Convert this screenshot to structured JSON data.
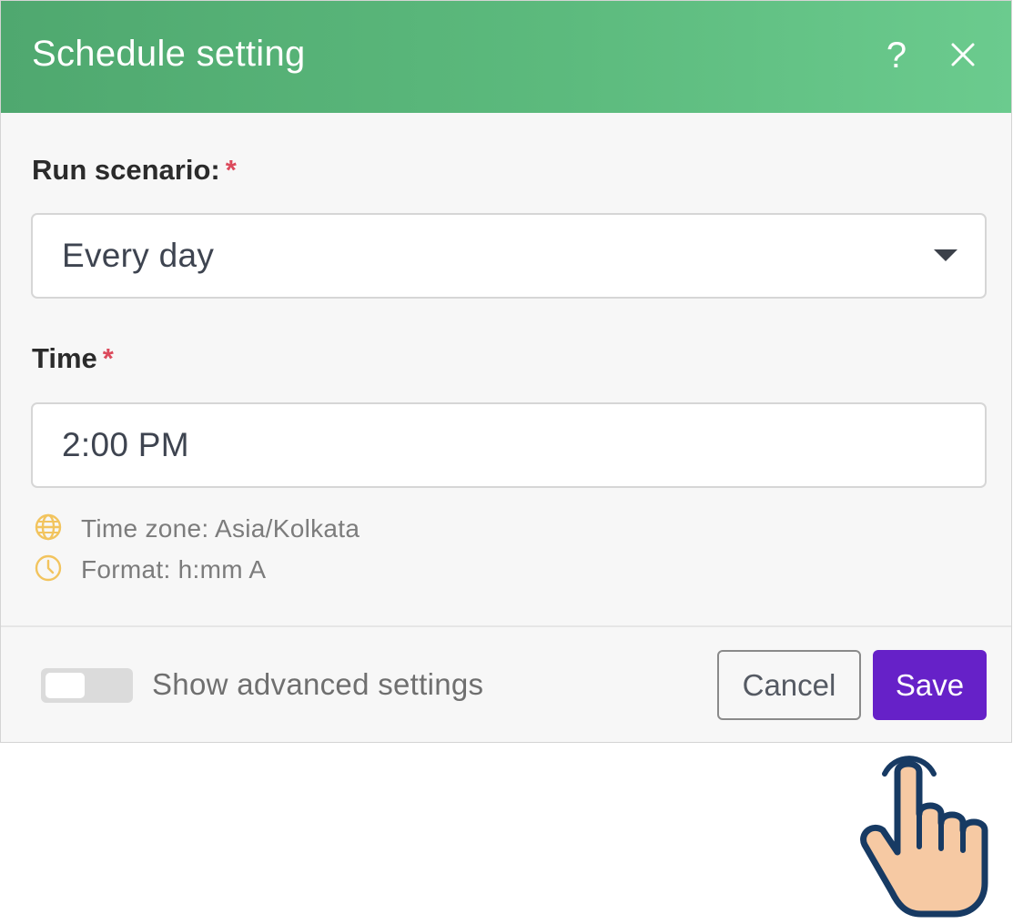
{
  "dialog": {
    "title": "Schedule setting",
    "help_label": "?",
    "close_icon": "close-icon"
  },
  "run_scenario": {
    "label": "Run scenario:",
    "required_mark": "*",
    "value": "Every day",
    "dropdown_icon": "caret-down-icon"
  },
  "time": {
    "label": "Time",
    "required_mark": "*",
    "value": "2:00 PM"
  },
  "hints": [
    {
      "icon": "globe-icon",
      "text": "Time zone: Asia/Kolkata"
    },
    {
      "icon": "clock-icon",
      "text": "Format: h:mm A"
    }
  ],
  "footer": {
    "advanced_toggle_label": "Show advanced settings",
    "advanced_toggle_on": false,
    "cancel_label": "Cancel",
    "save_label": "Save"
  },
  "pointer": {
    "icon": "hand-pointer-icon"
  },
  "colors": {
    "header_gradient_start": "#4fa86f",
    "header_gradient_end": "#6bcb8e",
    "primary": "#6621c8",
    "required": "#dc4a5c",
    "hint_icon": "#f2c45e",
    "hand_fill": "#f6c9a3",
    "hand_outline": "#173a63"
  }
}
